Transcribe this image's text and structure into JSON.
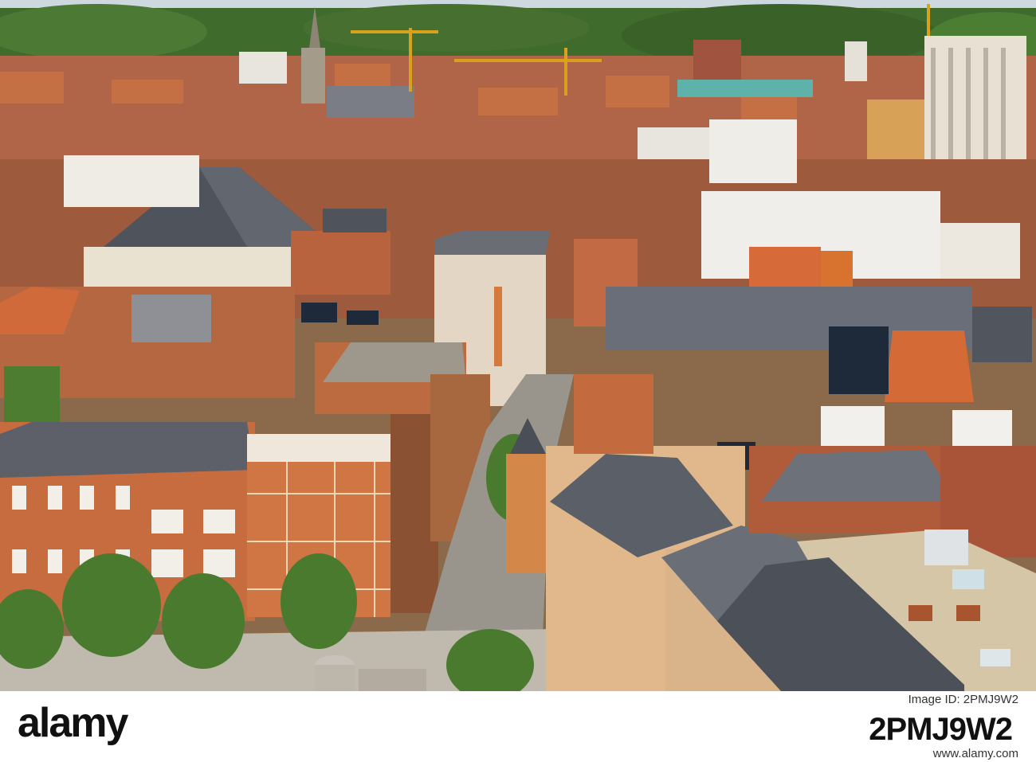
{
  "image": {
    "description_icon": "aerial-city-photo",
    "palette": {
      "roof_orange": "#c8643a",
      "roof_slate": "#5a5f68",
      "brick": "#b86a44",
      "trees": "#3f6b2c",
      "sky": "#cdd9df",
      "stone": "#e6dccb"
    }
  },
  "footer": {
    "logo_text": "alamy",
    "image_id_label": "Image ID: 2PMJ9W2",
    "image_code": "2PMJ9W2",
    "site_url": "www.alamy.com"
  }
}
